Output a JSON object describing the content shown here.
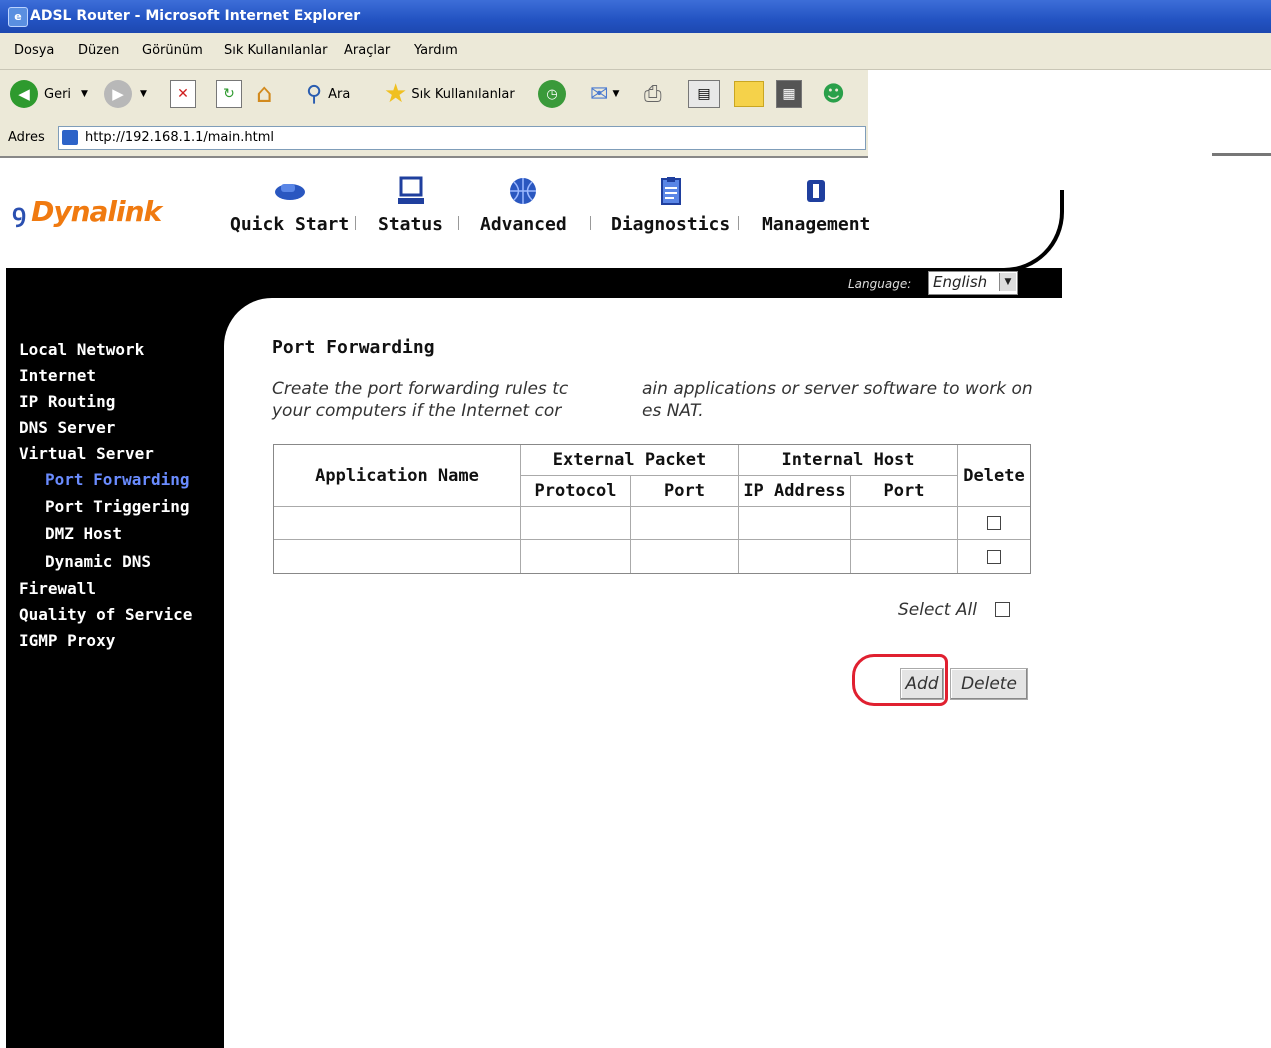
{
  "window": {
    "title": "ADSL Router - Microsoft Internet Explorer"
  },
  "menu": [
    "Dosya",
    "Düzen",
    "Görünüm",
    "Sık Kullanılanlar",
    "Araçlar",
    "Yardım"
  ],
  "toolbar": {
    "back_label": "Geri",
    "search_label": "Ara",
    "favorites_label": "Sık Kullanılanlar"
  },
  "address": {
    "label": "Adres",
    "url": "http://192.168.1.1/main.html"
  },
  "router": {
    "logo": "Dynalink",
    "nav": [
      "Quick Start",
      "Status",
      "Advanced",
      "Diagnostics",
      "Management"
    ],
    "language_label": "Language:",
    "language_value": "English"
  },
  "sidebar": {
    "items": [
      "Local Network",
      "Internet",
      "IP Routing",
      "DNS Server",
      "Virtual Server"
    ],
    "sub_items": [
      "Port Forwarding",
      "Port Triggering",
      "DMZ Host",
      "Dynamic DNS"
    ],
    "items_after": [
      "Firewall",
      "Quality of Service",
      "IGMP Proxy"
    ],
    "active": "Port Forwarding"
  },
  "main": {
    "title": "Port Forwarding",
    "desc_line1_a": "Create the port forwarding rules tc",
    "desc_line1_b": "ain applications or server software to work on",
    "desc_line2_a": "your computers if the Internet cor",
    "desc_line2_b": "es NAT.",
    "table": {
      "app_name": "Application Name",
      "external_packet": "External Packet",
      "internal_host": "Internal Host",
      "delete": "Delete",
      "protocol": "Protocol",
      "port": "Port",
      "ip_address": "IP Address",
      "port2": "Port"
    },
    "select_all": "Select All",
    "add_button": "Add",
    "delete_button": "Delete"
  },
  "colors": {
    "active_link": "#6a8cff",
    "annotation": "#e02030",
    "logo": "#f07a10"
  }
}
